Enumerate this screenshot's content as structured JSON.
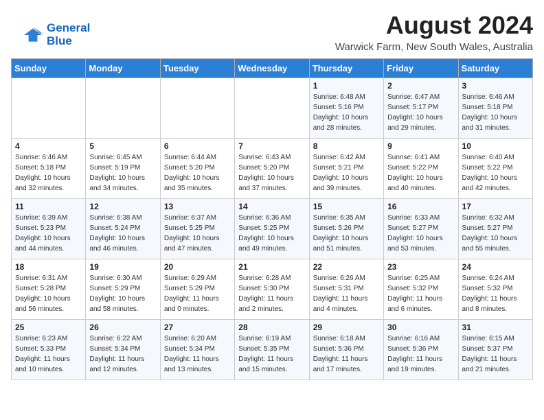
{
  "logo": {
    "line1": "General",
    "line2": "Blue"
  },
  "header": {
    "month_year": "August 2024",
    "location": "Warwick Farm, New South Wales, Australia"
  },
  "weekdays": [
    "Sunday",
    "Monday",
    "Tuesday",
    "Wednesday",
    "Thursday",
    "Friday",
    "Saturday"
  ],
  "weeks": [
    [
      {
        "day": "",
        "info": ""
      },
      {
        "day": "",
        "info": ""
      },
      {
        "day": "",
        "info": ""
      },
      {
        "day": "",
        "info": ""
      },
      {
        "day": "1",
        "info": "Sunrise: 6:48 AM\nSunset: 5:16 PM\nDaylight: 10 hours\nand 28 minutes."
      },
      {
        "day": "2",
        "info": "Sunrise: 6:47 AM\nSunset: 5:17 PM\nDaylight: 10 hours\nand 29 minutes."
      },
      {
        "day": "3",
        "info": "Sunrise: 6:46 AM\nSunset: 5:18 PM\nDaylight: 10 hours\nand 31 minutes."
      }
    ],
    [
      {
        "day": "4",
        "info": "Sunrise: 6:46 AM\nSunset: 5:18 PM\nDaylight: 10 hours\nand 32 minutes."
      },
      {
        "day": "5",
        "info": "Sunrise: 6:45 AM\nSunset: 5:19 PM\nDaylight: 10 hours\nand 34 minutes."
      },
      {
        "day": "6",
        "info": "Sunrise: 6:44 AM\nSunset: 5:20 PM\nDaylight: 10 hours\nand 35 minutes."
      },
      {
        "day": "7",
        "info": "Sunrise: 6:43 AM\nSunset: 5:20 PM\nDaylight: 10 hours\nand 37 minutes."
      },
      {
        "day": "8",
        "info": "Sunrise: 6:42 AM\nSunset: 5:21 PM\nDaylight: 10 hours\nand 39 minutes."
      },
      {
        "day": "9",
        "info": "Sunrise: 6:41 AM\nSunset: 5:22 PM\nDaylight: 10 hours\nand 40 minutes."
      },
      {
        "day": "10",
        "info": "Sunrise: 6:40 AM\nSunset: 5:22 PM\nDaylight: 10 hours\nand 42 minutes."
      }
    ],
    [
      {
        "day": "11",
        "info": "Sunrise: 6:39 AM\nSunset: 5:23 PM\nDaylight: 10 hours\nand 44 minutes."
      },
      {
        "day": "12",
        "info": "Sunrise: 6:38 AM\nSunset: 5:24 PM\nDaylight: 10 hours\nand 46 minutes."
      },
      {
        "day": "13",
        "info": "Sunrise: 6:37 AM\nSunset: 5:25 PM\nDaylight: 10 hours\nand 47 minutes."
      },
      {
        "day": "14",
        "info": "Sunrise: 6:36 AM\nSunset: 5:25 PM\nDaylight: 10 hours\nand 49 minutes."
      },
      {
        "day": "15",
        "info": "Sunrise: 6:35 AM\nSunset: 5:26 PM\nDaylight: 10 hours\nand 51 minutes."
      },
      {
        "day": "16",
        "info": "Sunrise: 6:33 AM\nSunset: 5:27 PM\nDaylight: 10 hours\nand 53 minutes."
      },
      {
        "day": "17",
        "info": "Sunrise: 6:32 AM\nSunset: 5:27 PM\nDaylight: 10 hours\nand 55 minutes."
      }
    ],
    [
      {
        "day": "18",
        "info": "Sunrise: 6:31 AM\nSunset: 5:28 PM\nDaylight: 10 hours\nand 56 minutes."
      },
      {
        "day": "19",
        "info": "Sunrise: 6:30 AM\nSunset: 5:29 PM\nDaylight: 10 hours\nand 58 minutes."
      },
      {
        "day": "20",
        "info": "Sunrise: 6:29 AM\nSunset: 5:29 PM\nDaylight: 11 hours\nand 0 minutes."
      },
      {
        "day": "21",
        "info": "Sunrise: 6:28 AM\nSunset: 5:30 PM\nDaylight: 11 hours\nand 2 minutes."
      },
      {
        "day": "22",
        "info": "Sunrise: 6:26 AM\nSunset: 5:31 PM\nDaylight: 11 hours\nand 4 minutes."
      },
      {
        "day": "23",
        "info": "Sunrise: 6:25 AM\nSunset: 5:32 PM\nDaylight: 11 hours\nand 6 minutes."
      },
      {
        "day": "24",
        "info": "Sunrise: 6:24 AM\nSunset: 5:32 PM\nDaylight: 11 hours\nand 8 minutes."
      }
    ],
    [
      {
        "day": "25",
        "info": "Sunrise: 6:23 AM\nSunset: 5:33 PM\nDaylight: 11 hours\nand 10 minutes."
      },
      {
        "day": "26",
        "info": "Sunrise: 6:22 AM\nSunset: 5:34 PM\nDaylight: 11 hours\nand 12 minutes."
      },
      {
        "day": "27",
        "info": "Sunrise: 6:20 AM\nSunset: 5:34 PM\nDaylight: 11 hours\nand 13 minutes."
      },
      {
        "day": "28",
        "info": "Sunrise: 6:19 AM\nSunset: 5:35 PM\nDaylight: 11 hours\nand 15 minutes."
      },
      {
        "day": "29",
        "info": "Sunrise: 6:18 AM\nSunset: 5:36 PM\nDaylight: 11 hours\nand 17 minutes."
      },
      {
        "day": "30",
        "info": "Sunrise: 6:16 AM\nSunset: 5:36 PM\nDaylight: 11 hours\nand 19 minutes."
      },
      {
        "day": "31",
        "info": "Sunrise: 6:15 AM\nSunset: 5:37 PM\nDaylight: 11 hours\nand 21 minutes."
      }
    ]
  ]
}
